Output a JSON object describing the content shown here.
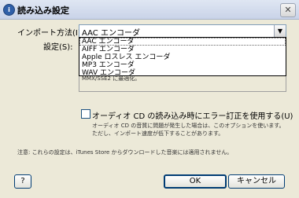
{
  "window": {
    "title": "読み込み設定",
    "icon_glyph": "i",
    "close_glyph": "✕"
  },
  "import": {
    "label": "インポート方法(I):",
    "selected_value": "AAC エンコーダ",
    "options": [
      "AAC エンコーダ",
      "AIFF エンコーダ",
      "Apple ロスレス エンコーダ",
      "MP3 エンコーダ",
      "WAV エンコーダ"
    ]
  },
  "settings": {
    "label": "設定(S):",
    "note": "MMX/SSE2 に最適化。"
  },
  "error_correction": {
    "checked": false,
    "label": "オーディオ CD の読み込み時にエラー訂正を使用する(U)",
    "description": "オーディオ CD の音質に問題が発生した場合は、このオプションを使います。ただし、インポート速度が低下することがあります。"
  },
  "footer_note": "注意: これらの設定は、iTunes Store からダウンロードした音楽には適用されません。",
  "buttons": {
    "help": "?",
    "ok": "OK",
    "cancel": "キャンセル"
  }
}
